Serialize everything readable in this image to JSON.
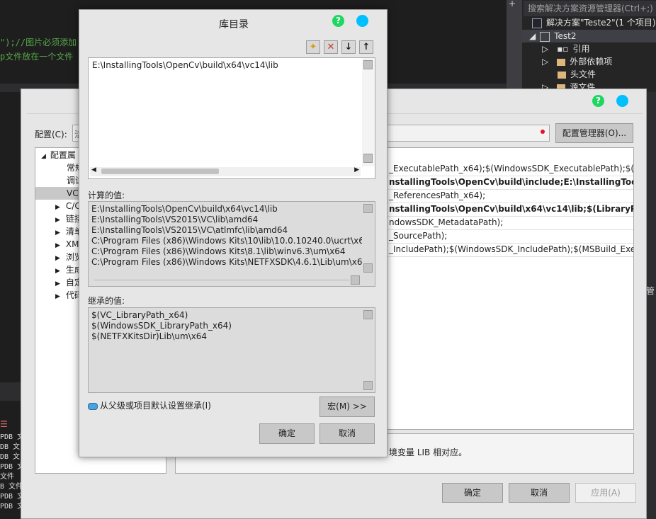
{
  "background": {
    "code_lines": [
      {
        "text": "\");//图片必须添加",
        "color": "#57a64a"
      },
      {
        "text": "p文件放在一个文件",
        "color": "#57a64a"
      }
    ],
    "solution_explorer": {
      "search_placeholder": "搜索解决方案资源管理器(Ctrl+;)",
      "items": [
        {
          "label": "解决方案\"Teste2\"(1 个项目)"
        },
        {
          "label": "Test2"
        },
        {
          "label": "引用"
        },
        {
          "label": "外部依赖项"
        },
        {
          "label": "头文件"
        },
        {
          "label": "源文件"
        }
      ],
      "side_fragment": "管"
    },
    "output_lines": [
      "PDB 文",
      "DB 文",
      "DB 文",
      "PDB 文",
      " 文件",
      "B 文件",
      "PDB 文",
      "PDB 文"
    ]
  },
  "property_dialog": {
    "config_label": "配置(C):",
    "config_fragment": "活",
    "config_manager_label": "配置管理器(O)...",
    "tree": [
      {
        "label": "配置属",
        "expander": "◢"
      },
      {
        "label": "常规",
        "expander": ""
      },
      {
        "label": "调试",
        "expander": ""
      },
      {
        "label": "VC",
        "expander": ""
      },
      {
        "label": "C/C",
        "expander": "▶"
      },
      {
        "label": "链接",
        "expander": "▶"
      },
      {
        "label": "清单",
        "expander": "▶"
      },
      {
        "label": "XM",
        "expander": "▶"
      },
      {
        "label": "浏览",
        "expander": "▶"
      },
      {
        "label": "生成",
        "expander": "▶"
      },
      {
        "label": "自定",
        "expander": "▶"
      },
      {
        "label": "代码",
        "expander": "▶"
      }
    ],
    "grid_rows": [
      {
        "text": "_ExecutablePath_x64);$(WindowsSDK_ExecutablePath);$(VS_E",
        "bold": false
      },
      {
        "text": "nstallingTools\\OpenCv\\build\\include;E:\\InstallingTools\\Ope",
        "bold": true
      },
      {
        "text": "_ReferencesPath_x64);",
        "bold": false
      },
      {
        "text": "nstallingTools\\OpenCv\\build\\x64\\vc14\\lib;$(LibraryPath)",
        "bold": true
      },
      {
        "text": "ndowsSDK_MetadataPath);",
        "bold": false
      },
      {
        "text": "_SourcePath);",
        "bold": false
      },
      {
        "text": "_IncludePath);$(WindowsSDK_IncludePath);$(MSBuild_Executa",
        "bold": false
      }
    ],
    "description": "境变量 LIB 相对应。",
    "ok_label": "确定",
    "cancel_label": "取消",
    "apply_label": "应用(A)"
  },
  "library_dialog": {
    "title": "库目录",
    "toolbar": {
      "new_line": "✦",
      "delete": "✕",
      "move_down": "↓",
      "move_up": "↑"
    },
    "entries": [
      "E:\\InstallingTools\\OpenCv\\build\\x64\\vc14\\lib"
    ],
    "evaluated_label": "计算的值:",
    "evaluated_values": [
      "E:\\InstallingTools\\OpenCv\\build\\x64\\vc14\\lib",
      "E:\\InstallingTools\\VS2015\\VC\\lib\\amd64",
      "E:\\InstallingTools\\VS2015\\VC\\atlmfc\\lib\\amd64",
      "C:\\Program Files (x86)\\Windows Kits\\10\\lib\\10.0.10240.0\\ucrt\\x64",
      "C:\\Program Files (x86)\\Windows Kits\\8.1\\lib\\winv6.3\\um\\x64",
      "C:\\Program Files (x86)\\Windows Kits\\NETFXSDK\\4.6.1\\Lib\\um\\x64"
    ],
    "inherited_label": "继承的值:",
    "inherited_values": [
      "$(VC_LibraryPath_x64)",
      "$(WindowsSDK_LibraryPath_x64)",
      "$(NETFXKitsDir)Lib\\um\\x64"
    ],
    "inherit_checkbox_label": "从父级或项目默认设置继承(I)",
    "macros_label": "宏(M) >>",
    "ok_label": "确定",
    "cancel_label": "取消"
  },
  "colors": {
    "help_icon": "#1ed760",
    "dot_icon": "#00bfff",
    "dialog_bg": "#e6e6e6"
  }
}
